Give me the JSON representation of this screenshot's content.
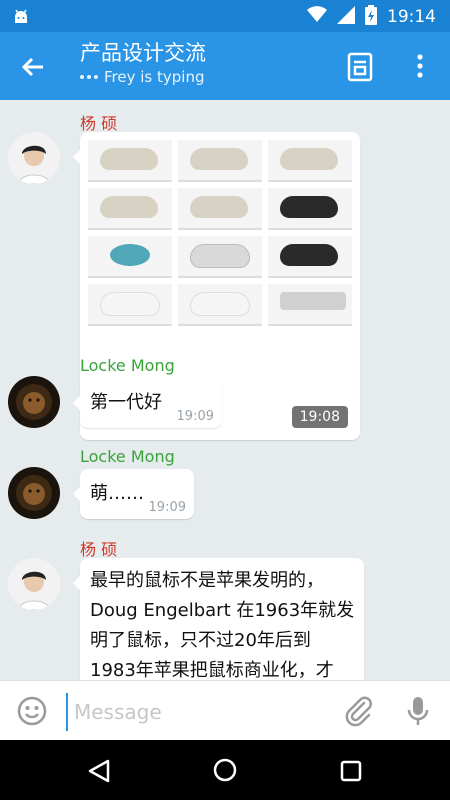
{
  "status_bar": {
    "time": "19:14"
  },
  "header": {
    "title": "产品设计交流",
    "subtitle": "Frey is typing"
  },
  "colors": {
    "appbar": "#2a95e6",
    "statusbar": "#1a82d2",
    "name_red": "#d03a2b",
    "name_green": "#3aa33a"
  },
  "messages": [
    {
      "sender": "杨 硕",
      "type": "image",
      "time": "19:08"
    },
    {
      "sender": "Locke Mong",
      "type": "text",
      "text": "第一代好",
      "time": "19:09"
    },
    {
      "sender": "Locke Mong",
      "type": "text",
      "text": "萌……",
      "time": "19:09"
    },
    {
      "sender": "杨 硕",
      "type": "text",
      "lines": [
        "最早的鼠标不是苹果发明的，",
        "Doug Engelbart 在1963年就发",
        "明了鼠标，只不过20年后到",
        "1983年苹果把鼠标商业化，才"
      ]
    }
  ],
  "input": {
    "placeholder": "Message"
  }
}
